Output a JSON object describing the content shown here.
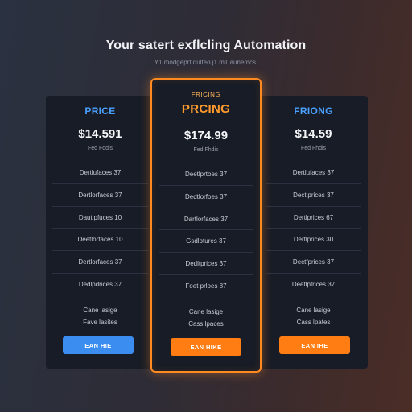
{
  "header": {
    "title": "Your satert exflcling Automation",
    "subtitle": "Y1 modgeprt dulteo j1 m1 aunemcs."
  },
  "plans": [
    {
      "badge": "",
      "name": "PRICE",
      "price": "$14.591",
      "period": "Fed Fddis",
      "features": [
        "Dertlufaces 37",
        "Dertlorfaces 37",
        "Dautlpfuces 10",
        "Deetlorfaces 10",
        "Dertlorfaces 37",
        "Dedlpdrices 37"
      ],
      "extras": [
        "Cane lasige",
        "Fave lasites"
      ],
      "cta": "EAN HIE"
    },
    {
      "badge": "FRICING",
      "name": "PRCING",
      "price": "$174.99",
      "period": "Fed Fhdis",
      "features": [
        "Deetlprtoes 37",
        "Dedtlorfoes 37",
        "Dartlorfaces 37",
        "Gsdlptures 37",
        "Dedltprices 37",
        "Foet prloes 87"
      ],
      "extras": [
        "Cane lasige",
        "Cass lpaces"
      ],
      "cta": "EAN HIKE"
    },
    {
      "badge": "",
      "name": "FRIONG",
      "price": "$14.59",
      "period": "Fed Fhdis",
      "features": [
        "Dertlufaces 37",
        "Dectlprices 37",
        "Dertlprices 67",
        "Dertlprices 30",
        "Dectfprices 37",
        "Deetlpfrices 37"
      ],
      "extras": [
        "Cane lasige",
        "Cass lpates"
      ],
      "cta": "EAN IHE"
    }
  ],
  "colors": {
    "accent_blue": "#3b8ef0",
    "accent_orange": "#ff7d12",
    "card_bg": "#171c26"
  }
}
